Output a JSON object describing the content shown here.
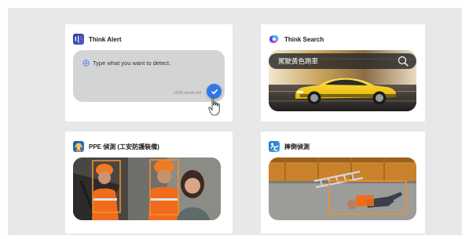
{
  "cards": {
    "think_alert": {
      "title": "Think Alert",
      "icon": "alert-ai-icon",
      "input_placeholder": "Type what you want to detect.",
      "word_counter": "12/40 words left",
      "confirm_icon": "checkmark-icon"
    },
    "think_search": {
      "title": "Think Search",
      "icon": "think-search-logo-icon",
      "query": "駕駛黃色跑車",
      "search_icon": "magnifier-icon",
      "image": "yellow-sports-car-photo"
    },
    "ppe": {
      "title": "PPE 偵測 (工安防護裝備)",
      "icon": "hard-hat-worker-icon",
      "image": "workers-with-hard-hats-photo"
    },
    "fall": {
      "title": "摔倒偵測",
      "icon": "falling-person-icon",
      "image": "fallen-worker-ladder-photo"
    }
  },
  "colors": {
    "background": "#e8e8e9",
    "accent": "#2f78e5",
    "detection_box": "#f0902e"
  }
}
